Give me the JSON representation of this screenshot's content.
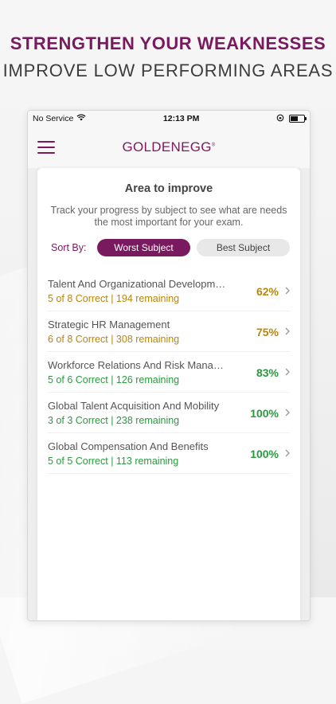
{
  "banner": {
    "line1": "STRENGTHEN YOUR WEAKNESSES",
    "line2": "IMPROVE LOW PERFORMING AREAS"
  },
  "status_bar": {
    "carrier": "No Service",
    "time": "12:13 PM"
  },
  "app_bar": {
    "logo_part1": "GOLDEN",
    "logo_part2": "EGG",
    "logo_mark": "®"
  },
  "card": {
    "title": "Area to improve",
    "description": "Track your progress by subject to see what are needs the most important for your exam.",
    "sort_label": "Sort By:",
    "sort_options": [
      "Worst Subject",
      "Best Subject"
    ],
    "selected_sort": "Worst Subject"
  },
  "subjects": [
    {
      "name": "Talent And Organizational Developm…",
      "meta": "5 of 8  Correct | 194 remaining",
      "percent": "62%",
      "color": "#b8860b"
    },
    {
      "name": "Strategic HR Management",
      "meta": "6 of 8  Correct | 308 remaining",
      "percent": "75%",
      "color": "#b8860b"
    },
    {
      "name": "Workforce Relations And Risk Mana…",
      "meta": "5 of 6  Correct | 126 remaining",
      "percent": "83%",
      "color": "#2a9a3f"
    },
    {
      "name": "Global Talent Acquisition And Mobility",
      "meta": "3 of 3  Correct | 238 remaining",
      "percent": "100%",
      "color": "#2a9a3f"
    },
    {
      "name": "Global Compensation And Benefits",
      "meta": "5 of 5  Correct | 113 remaining",
      "percent": "100%",
      "color": "#2a9a3f"
    }
  ],
  "colors": {
    "brand": "#7a1a5e",
    "warning": "#b8860b",
    "success": "#2a9a3f"
  }
}
